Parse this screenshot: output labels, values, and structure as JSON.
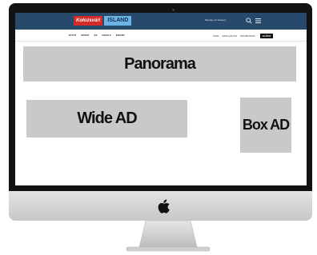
{
  "site": {
    "logo_primary": "Kolozsvári",
    "logo_secondary": "ISLAND",
    "date": "Monday 13 January"
  },
  "nav": {
    "left": [
      "NYITÓ",
      "SPORT",
      "ÉS",
      "REGILS",
      "BIZONT"
    ],
    "right": [
      "SIGN",
      "SZOLGÁLTAT",
      "PROMOTION"
    ],
    "cta": "ELŐFIZ"
  },
  "ads": {
    "panorama": "Panorama",
    "wide": "Wide AD",
    "box": "Box AD"
  },
  "icons": [
    "search-icon",
    "menu-icon",
    "apple-logo-icon"
  ],
  "colors": {
    "header": "#27496b",
    "ad_placeholder": "#c9c9c9",
    "bezel": "#111213",
    "logo_red": "#d42a2a",
    "logo_blue": "#6db3e4"
  }
}
